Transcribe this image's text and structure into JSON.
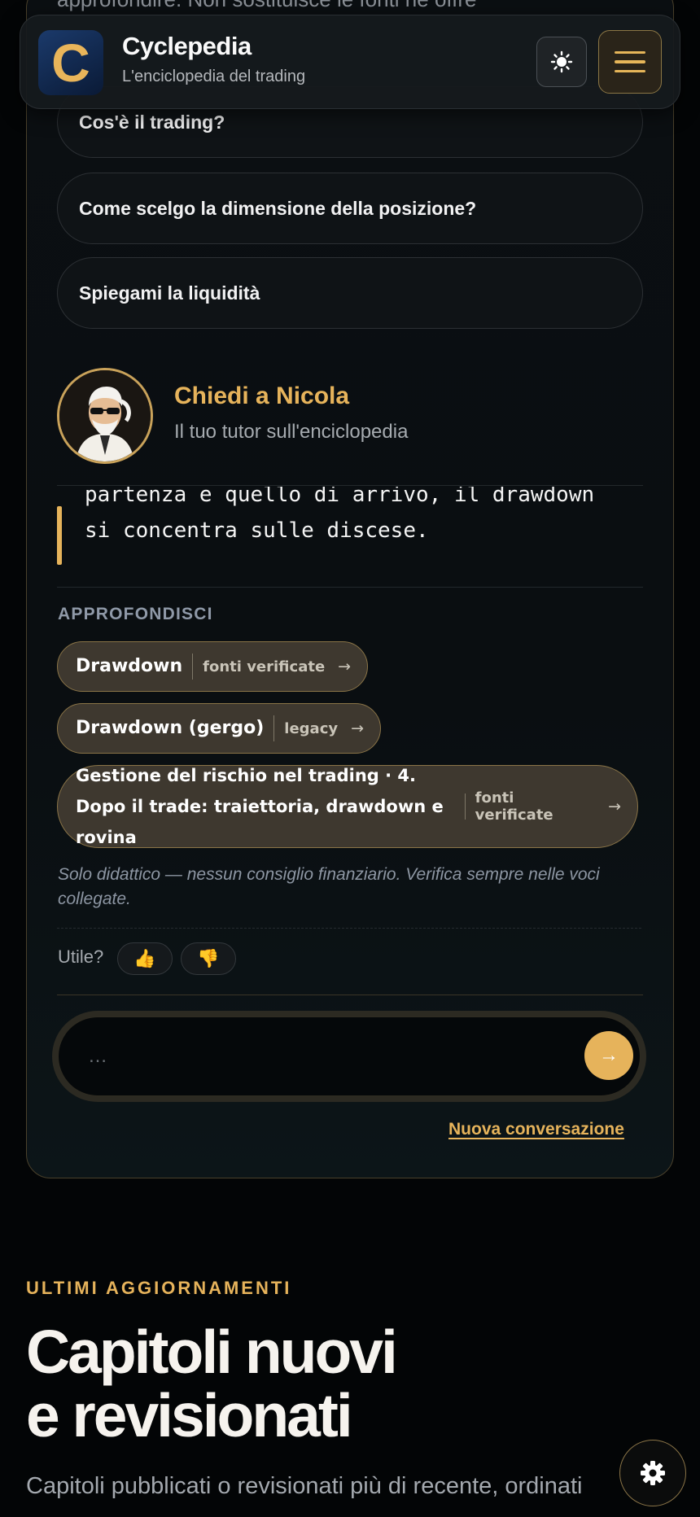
{
  "header": {
    "logo_letter": "C",
    "title": "Cyclepedia",
    "subtitle": "L'enciclopedia del trading",
    "theme_icon": "sun-icon",
    "menu_icon": "hamburger-icon"
  },
  "chat": {
    "top_text": "approfondire. Non sostituisce le fonti né offre",
    "suggestions": [
      "Cos'è il trading?",
      "Come scelgo la dimensione della posizione?",
      "Spiegami la liquidità"
    ],
    "tutor": {
      "name": "Chiedi a Nicola",
      "subtitle": "Il tuo tutor sull'enciclopedia"
    },
    "answer_lines": [
      "partenza e quello di arrivo, il drawdown",
      "si concentra sulle discese."
    ],
    "further_label": "APPROFONDISCI",
    "links": [
      {
        "title": "Drawdown",
        "tag": "fonti verificate",
        "arrow": "→"
      },
      {
        "title": "Drawdown (gergo)",
        "tag": "legacy",
        "arrow": "→"
      },
      {
        "title": "Gestione del rischio nel trading · 4. Dopo il trade: traiettoria, drawdown e rovina",
        "tag": "fonti verificate",
        "arrow": "→"
      }
    ],
    "disclaimer": "Solo didattico — nessun consiglio finanziario. Verifica sempre nelle voci collegate.",
    "feedback": {
      "label": "Utile?",
      "up": "👍",
      "down": "👎"
    },
    "input_placeholder": "…",
    "send_arrow": "→",
    "new_conversation": "Nuova conversazione"
  },
  "updates": {
    "kicker": "ULTIMI AGGIORNAMENTI",
    "title_line1": "Capitoli nuovi",
    "title_line2": "e revisionati",
    "subtitle": "Capitoli pubblicati o revisionati più di recente, ordinati"
  },
  "colors": {
    "accent": "#e6b35b",
    "background": "#030506",
    "chip_bg": "#3e382f"
  }
}
